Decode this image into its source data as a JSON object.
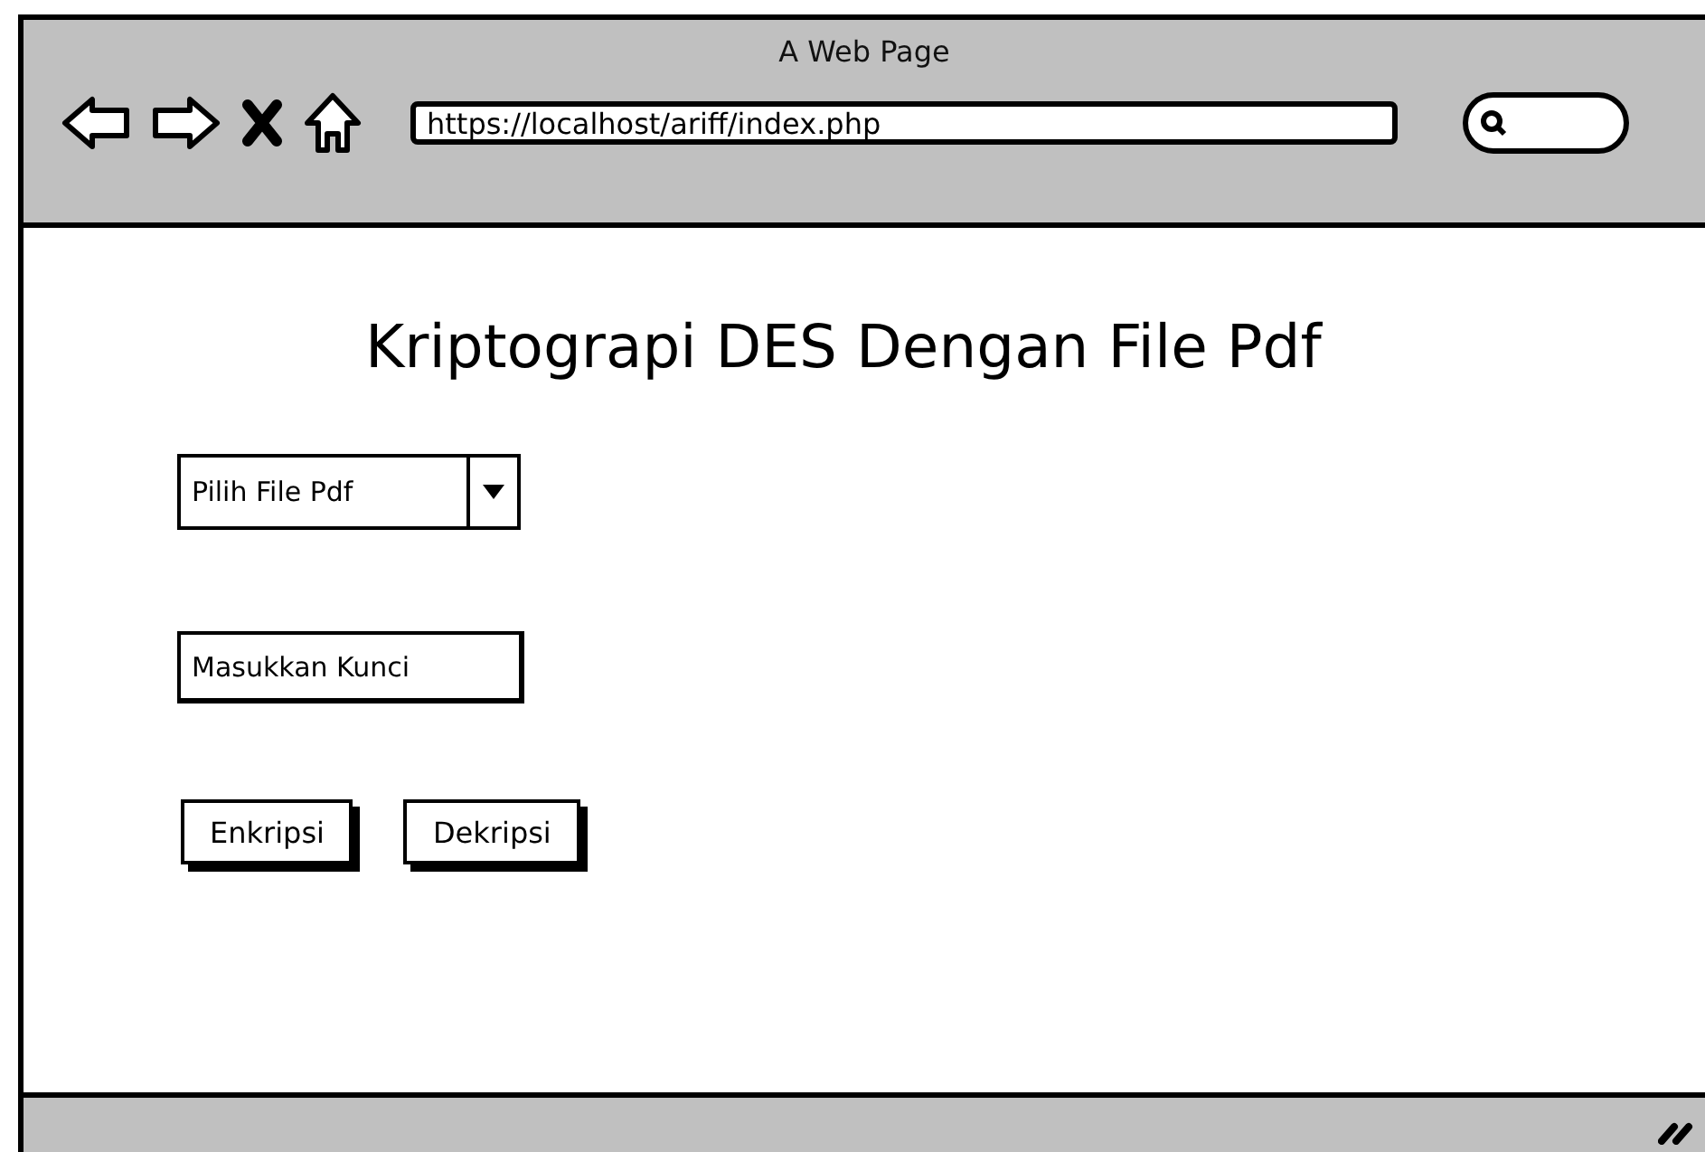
{
  "window": {
    "title": "A Web Page"
  },
  "address_bar": {
    "url": "https://localhost/ariff/index.php"
  },
  "heading": "Kriptograpi DES Dengan File Pdf",
  "file_dropdown": {
    "label": "Pilih File Pdf"
  },
  "key_field": {
    "placeholder": "Masukkan Kunci"
  },
  "buttons": [
    "Enkripsi",
    "Dekripsi"
  ]
}
